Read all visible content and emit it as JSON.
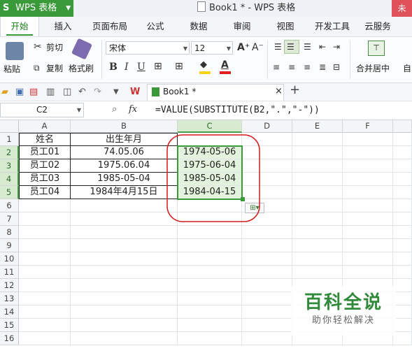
{
  "title_bar": {
    "app_label": "WPS 表格",
    "doc_title": "Book1 * - WPS 表格",
    "right_label": "未"
  },
  "menu": {
    "tabs": [
      "开始",
      "插入",
      "页面布局",
      "公式",
      "数据",
      "审阅",
      "视图",
      "开发工具",
      "云服务"
    ]
  },
  "ribbon": {
    "paste": "粘贴",
    "cut": "剪切",
    "copy": "复制",
    "format_painter": "格式刷",
    "font_name": "宋体",
    "font_size": "12",
    "bold": "B",
    "italic": "I",
    "underline": "U",
    "font_grow": "A⁺",
    "font_shrink": "A⁻",
    "merge_center": "合并居中",
    "auto_label": "自",
    "colors": {
      "fill": "#f6d31a",
      "font": "#e02020"
    }
  },
  "quick_access": {
    "book_tab": "Book1 *",
    "close": "×",
    "add": "+"
  },
  "formula_bar": {
    "name_box": "C2",
    "fx": "fx",
    "formula": "=VALUE(SUBSTITUTE(B2,\".\",\"-\"))"
  },
  "sheet": {
    "columns": [
      "A",
      "B",
      "C",
      "D",
      "E",
      "F"
    ],
    "rows": [
      "1",
      "2",
      "3",
      "4",
      "5",
      "6",
      "7",
      "8",
      "9",
      "10",
      "11",
      "12",
      "13",
      "14",
      "15",
      "16"
    ],
    "cells": {
      "A1": "姓名",
      "B1": "出生年月",
      "A2": "员工01",
      "B2": "74.05.06",
      "C2": "1974-05-06",
      "A3": "员工02",
      "B3": "1975.06.04",
      "C3": "1975-06-04",
      "A4": "员工03",
      "B4": "1985-05-04",
      "C4": "1985-05-04",
      "A5": "员工04",
      "B5": "1984年4月15日",
      "C5": "1984-04-15"
    },
    "selected_column": "C",
    "selected_rows": [
      "2",
      "3",
      "4",
      "5"
    ]
  },
  "watermark": {
    "title": "百科全说",
    "subtitle": "助你轻松解决"
  }
}
